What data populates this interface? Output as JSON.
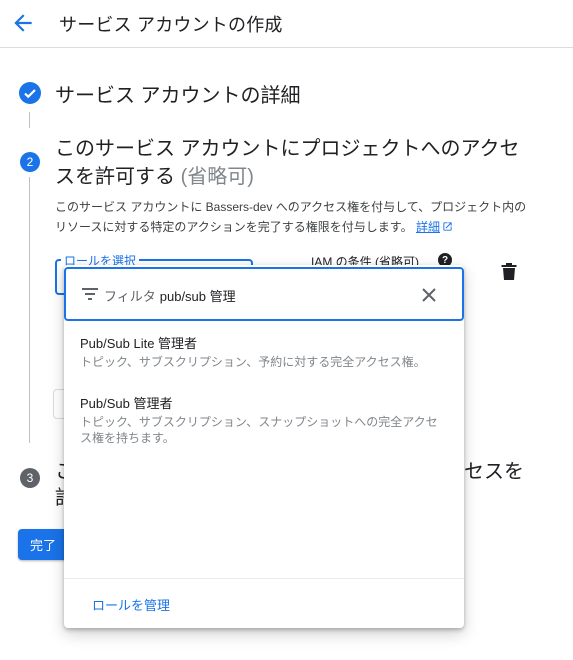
{
  "header": {
    "title": "サービス アカウントの作成",
    "back_icon": "arrow-back-icon"
  },
  "colors": {
    "accent": "#1a73e8",
    "step_inactive": "#5f6368",
    "muted_text": "#80868b"
  },
  "steps": [
    {
      "number": "1",
      "status": "completed",
      "title": "サービス アカウントの詳細"
    },
    {
      "number": "2",
      "status": "active",
      "title": "このサービス アカウントにプロジェクトへのアクセスを許可する",
      "optional": "(省略可)",
      "description": "このサービス アカウントに Bassers-dev へのアクセス権を付与して、プロジェクト内のリソースに対する特定のアクションを完了する権限を付与します。",
      "learn_more": "詳細"
    },
    {
      "number": "3",
      "status": "pending",
      "title_fragment_1": "こ",
      "title_fragment_2": "許",
      "title_fragment_3": "セスを"
    }
  ],
  "role_field": {
    "label": "ロールを選択"
  },
  "iam_condition": {
    "label": "IAM の条件 (省略可)"
  },
  "done_button": {
    "label": "完了"
  },
  "dropdown": {
    "filter_prefix": "フィルタ",
    "filter_value": "pub/sub 管理",
    "options": [
      {
        "title": "Pub/Sub Lite 管理者",
        "description": "トピック、サブスクリプション、予約に対する完全アクセス権。"
      },
      {
        "title": "Pub/Sub 管理者",
        "description": "トピック、サブスクリプション、スナップショットへの完全アクセス権を持ちます。"
      }
    ],
    "manage_roles": "ロールを管理"
  }
}
